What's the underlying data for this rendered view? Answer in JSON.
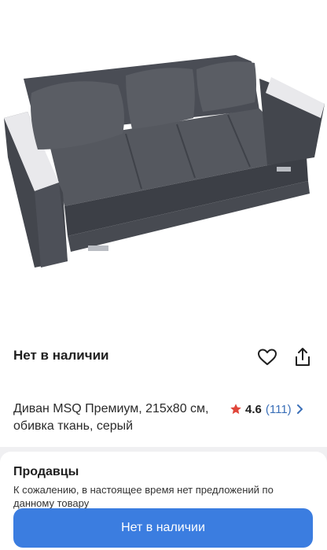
{
  "product": {
    "availability": "Нет в наличии",
    "title": "Диван MSQ Премиум, 215х80 см, обивка ткань, серый",
    "rating": "4.6",
    "reviews_count": "(111)"
  },
  "sellers": {
    "heading": "Продавцы",
    "message": "К сожалению, в настоящее время нет предложений по данному товару"
  },
  "cta": {
    "label": "Нет в наличии"
  },
  "colors": {
    "accent": "#3b7de0",
    "star": "#e0463a",
    "link": "#3a6fb8"
  },
  "icons": [
    "heart-icon",
    "share-icon",
    "star-icon",
    "chevron-right-icon"
  ]
}
